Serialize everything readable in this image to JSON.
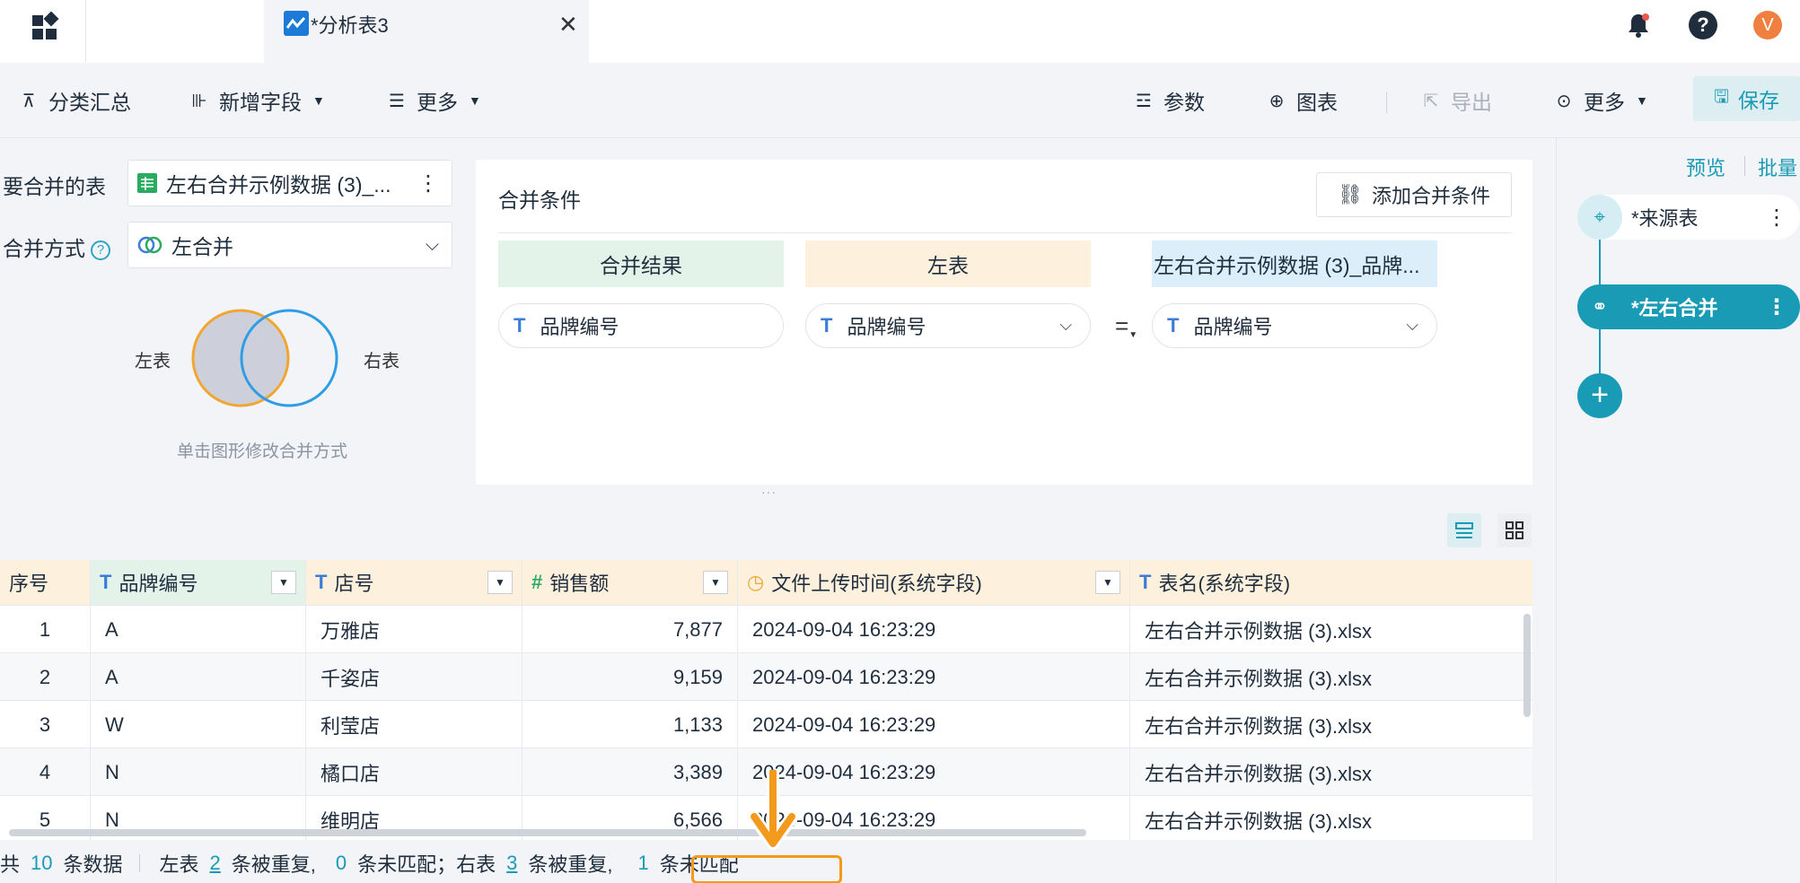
{
  "tabs": {
    "active_title": "*分析表3"
  },
  "toolbar": {
    "group_summary": "分类汇总",
    "add_field": "新增字段",
    "more_left": "更多",
    "params": "参数",
    "chart": "图表",
    "export": "导出",
    "more_right": "更多",
    "save": "保存"
  },
  "config": {
    "tables_label": "要合并的表",
    "table_value": "左右合并示例数据 (3)_...",
    "method_label": "合并方式",
    "method_value": "左合并",
    "venn_left": "左表",
    "venn_right": "右表",
    "venn_hint": "单击图形修改合并方式"
  },
  "condition": {
    "title": "合并条件",
    "add_button": "添加合并条件",
    "col_result": "合并结果",
    "col_left": "左表",
    "col_right": "左右合并示例数据 (3)_品牌...",
    "result_field": "品牌编号",
    "left_field": "品牌编号",
    "right_field": "品牌编号",
    "operator": "="
  },
  "flow": {
    "preview": "预览",
    "batch": "批量",
    "source_node": "*来源表",
    "merge_node": "*左右合并"
  },
  "table": {
    "headers": [
      "序号",
      "品牌编号",
      "店号",
      "销售额",
      "文件上传时间(系统字段)",
      "表名(系统字段)"
    ],
    "rows": [
      [
        "1",
        "A",
        "万雅店",
        "7,877",
        "2024-09-04 16:23:29",
        "左右合并示例数据 (3).xlsx"
      ],
      [
        "2",
        "A",
        "千姿店",
        "9,159",
        "2024-09-04 16:23:29",
        "左右合并示例数据 (3).xlsx"
      ],
      [
        "3",
        "W",
        "利莹店",
        "1,133",
        "2024-09-04 16:23:29",
        "左右合并示例数据 (3).xlsx"
      ],
      [
        "4",
        "N",
        "橘口店",
        "3,389",
        "2024-09-04 16:23:29",
        "左右合并示例数据 (3).xlsx"
      ],
      [
        "5",
        "N",
        "维明店",
        "6,566",
        "2024-09-04 16:23:29",
        "左右合并示例数据 (3).xlsx"
      ]
    ]
  },
  "status": {
    "prefix": "共",
    "total": "10",
    "total_suffix": "条数据",
    "left_label": "左表",
    "left_dup": "2",
    "dup_text": "条被重复,",
    "left_unmatched": "0",
    "unmatched_text_1": "条未匹配；右表",
    "right_dup": "3",
    "dup_text_2": "条被重复,",
    "right_unmatched": "1",
    "unmatched_text_2": "条未匹配"
  },
  "colors": {
    "accent": "#1a9bb5",
    "highlight": "#f39a1c",
    "result": "#e3f3ea",
    "left": "#fdf0dc",
    "right": "#dceefa"
  }
}
